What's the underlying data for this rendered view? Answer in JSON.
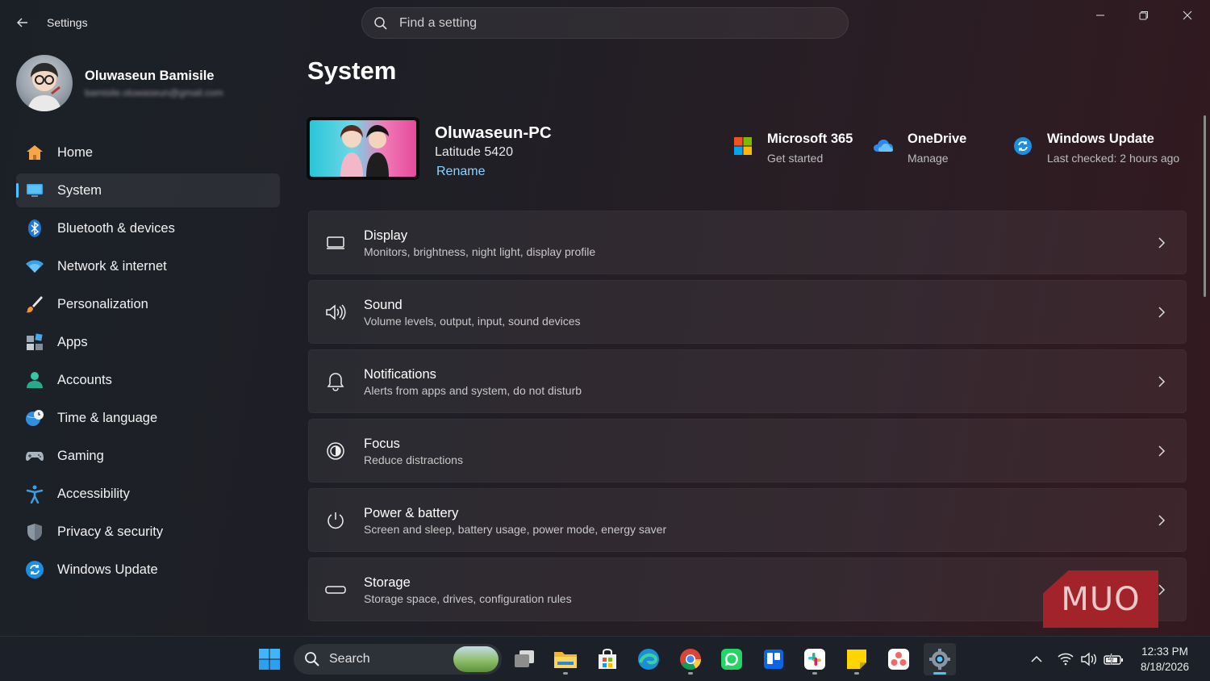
{
  "window": {
    "app_title": "Settings",
    "controls": [
      "minimize",
      "restore",
      "close"
    ]
  },
  "search": {
    "placeholder": "Find a setting"
  },
  "profile": {
    "name": "Oluwaseun Bamisile",
    "email": "bamisile.oluwaseun@gmail.com"
  },
  "sidebar": {
    "items": [
      {
        "label": "Home",
        "icon": "home-icon",
        "active": false
      },
      {
        "label": "System",
        "icon": "monitor-icon",
        "active": true
      },
      {
        "label": "Bluetooth & devices",
        "icon": "bluetooth-icon",
        "active": false
      },
      {
        "label": "Network & internet",
        "icon": "wifi-icon",
        "active": false
      },
      {
        "label": "Personalization",
        "icon": "brush-icon",
        "active": false
      },
      {
        "label": "Apps",
        "icon": "apps-icon",
        "active": false
      },
      {
        "label": "Accounts",
        "icon": "person-icon",
        "active": false
      },
      {
        "label": "Time & language",
        "icon": "globe-clock-icon",
        "active": false
      },
      {
        "label": "Gaming",
        "icon": "gamepad-icon",
        "active": false
      },
      {
        "label": "Accessibility",
        "icon": "accessibility-icon",
        "active": false
      },
      {
        "label": "Privacy & security",
        "icon": "shield-icon",
        "active": false
      },
      {
        "label": "Windows Update",
        "icon": "sync-icon",
        "active": false
      }
    ]
  },
  "main": {
    "page_title": "System",
    "device": {
      "name": "Oluwaseun-PC",
      "model": "Latitude 5420",
      "rename_label": "Rename"
    },
    "quick_links": [
      {
        "title": "Microsoft 365",
        "subtitle": "Get started",
        "icon": "microsoft-logo-icon"
      },
      {
        "title": "OneDrive",
        "subtitle": "Manage",
        "icon": "cloud-icon"
      },
      {
        "title": "Windows Update",
        "subtitle": "Last checked: 2 hours ago",
        "icon": "sync-icon"
      }
    ],
    "cards": [
      {
        "title": "Display",
        "subtitle": "Monitors, brightness, night light, display profile",
        "icon": "display-icon"
      },
      {
        "title": "Sound",
        "subtitle": "Volume levels, output, input, sound devices",
        "icon": "speaker-icon"
      },
      {
        "title": "Notifications",
        "subtitle": "Alerts from apps and system, do not disturb",
        "icon": "bell-icon"
      },
      {
        "title": "Focus",
        "subtitle": "Reduce distractions",
        "icon": "focus-icon"
      },
      {
        "title": "Power & battery",
        "subtitle": "Screen and sleep, battery usage, power mode, energy saver",
        "icon": "power-icon"
      },
      {
        "title": "Storage",
        "subtitle": "Storage space, drives, configuration rules",
        "icon": "storage-icon"
      }
    ]
  },
  "watermark": {
    "text": "MUO"
  },
  "taskbar": {
    "search_label": "Search",
    "apps": [
      "start-icon",
      "task-view-icon",
      "file-explorer-icon",
      "store-icon",
      "edge-icon",
      "chrome-icon",
      "whatsapp-icon",
      "trello-icon",
      "slack-icon",
      "sticky-notes-icon",
      "asana-icon",
      "settings-icon"
    ],
    "clock": {
      "time": "12:33 PM",
      "date": "8/18/2026"
    }
  },
  "colors": {
    "accent": "#4cc2ff",
    "link": "#8fd2ff",
    "watermark": "#a3232b"
  }
}
